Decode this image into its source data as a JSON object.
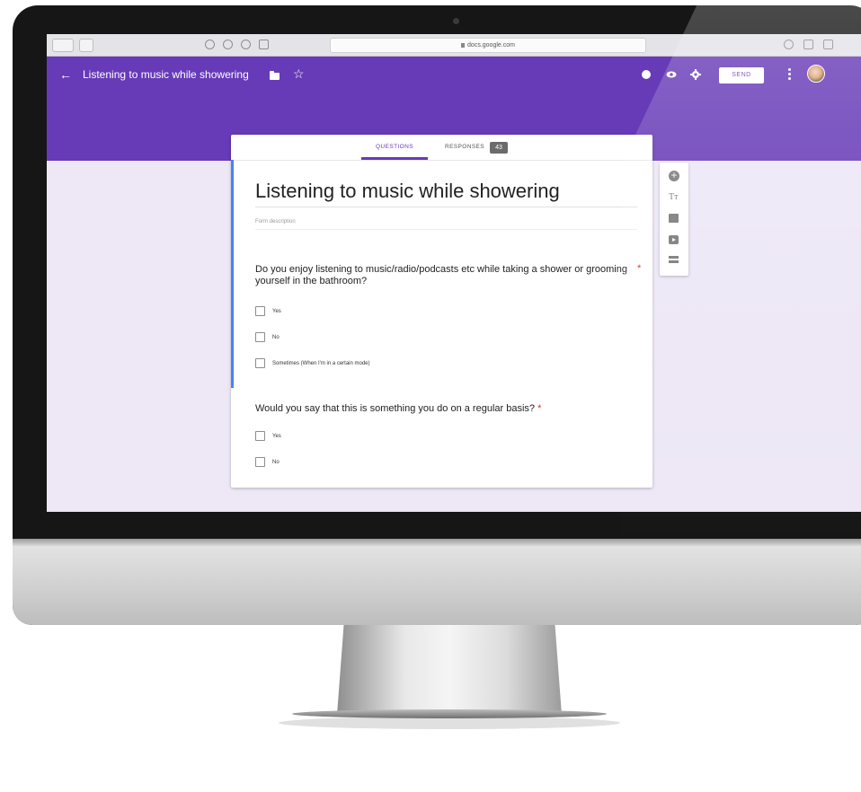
{
  "browser": {
    "url": "docs.google.com"
  },
  "header": {
    "title": "Listening to music while showering",
    "send_label": "SEND"
  },
  "tabs": {
    "questions": "QUESTIONS",
    "responses": "RESPONSES",
    "responses_count": "43"
  },
  "form": {
    "title": "Listening to music while showering",
    "description_placeholder": "Form description",
    "questions": [
      {
        "text": "Do you enjoy listening to music/radio/podcasts etc while taking a shower or grooming yourself in the bathroom?",
        "required_mark": "*",
        "options": [
          "Yes",
          "No",
          "Sometimes (When I'm in a certain mode)"
        ]
      },
      {
        "text": "Would you say that this is something you do on a regular basis?",
        "required_mark": "*",
        "options": [
          "Yes",
          "No"
        ]
      }
    ]
  },
  "side_toolbar": {
    "text_icon_glyph": "Tт"
  },
  "colors": {
    "header": "#673ab7",
    "background": "#ede7f6",
    "accent_bar": "#4285f4",
    "required": "#d93025"
  },
  "icons": [
    "back-arrow-icon",
    "folder-icon",
    "star-icon",
    "palette-icon",
    "eye-icon",
    "gear-icon",
    "more-vert-icon",
    "add-question-icon",
    "title-text-icon",
    "image-icon",
    "video-icon",
    "section-icon"
  ]
}
